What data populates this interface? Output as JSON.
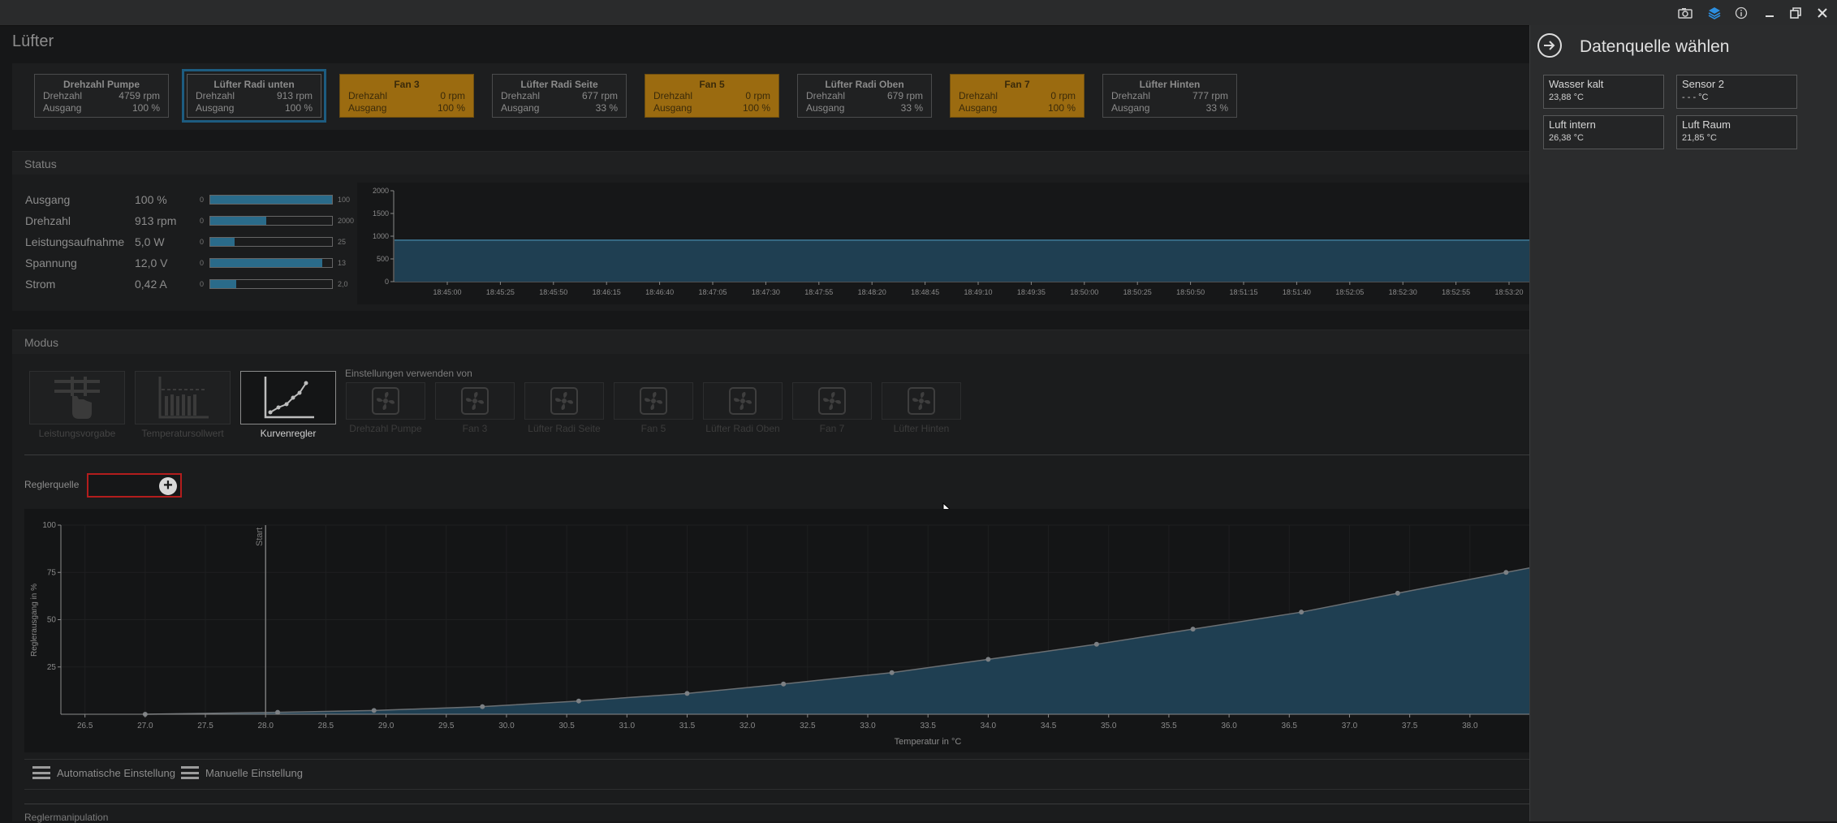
{
  "window": {
    "icons": [
      "camera-icon",
      "layers-icon",
      "info-icon",
      "minimize-icon",
      "restore-icon",
      "close-icon"
    ]
  },
  "page": {
    "title": "Lüfter"
  },
  "fans": [
    {
      "name": "Drehzahl Pumpe",
      "speed_label": "Drehzahl",
      "speed": "4759 rpm",
      "output_label": "Ausgang",
      "output": "100 %",
      "state": "normal"
    },
    {
      "name": "Lüfter Radi unten",
      "speed_label": "Drehzahl",
      "speed": "913 rpm",
      "output_label": "Ausgang",
      "output": "100 %",
      "state": "selected"
    },
    {
      "name": "Fan 3",
      "speed_label": "Drehzahl",
      "speed": "0 rpm",
      "output_label": "Ausgang",
      "output": "100 %",
      "state": "warning"
    },
    {
      "name": "Lüfter Radi Seite",
      "speed_label": "Drehzahl",
      "speed": "677 rpm",
      "output_label": "Ausgang",
      "output": "33 %",
      "state": "normal"
    },
    {
      "name": "Fan 5",
      "speed_label": "Drehzahl",
      "speed": "0 rpm",
      "output_label": "Ausgang",
      "output": "100 %",
      "state": "warning"
    },
    {
      "name": "Lüfter Radi Oben",
      "speed_label": "Drehzahl",
      "speed": "679 rpm",
      "output_label": "Ausgang",
      "output": "33 %",
      "state": "normal"
    },
    {
      "name": "Fan 7",
      "speed_label": "Drehzahl",
      "speed": "0 rpm",
      "output_label": "Ausgang",
      "output": "100 %",
      "state": "warning"
    },
    {
      "name": "Lüfter Hinten",
      "speed_label": "Drehzahl",
      "speed": "777 rpm",
      "output_label": "Ausgang",
      "output": "33 %",
      "state": "normal"
    }
  ],
  "status": {
    "header": "Status",
    "rows": [
      {
        "label": "Ausgang",
        "value": "100 %",
        "min": "0",
        "max": "100",
        "fraction": 1.0
      },
      {
        "label": "Drehzahl",
        "value": "913 rpm",
        "min": "0",
        "max": "2000",
        "fraction": 0.457
      },
      {
        "label": "Leistungsaufnahme",
        "value": "5,0 W",
        "min": "0",
        "max": "25",
        "fraction": 0.2
      },
      {
        "label": "Spannung",
        "value": "12,0 V",
        "min": "0",
        "max": "13",
        "fraction": 0.923
      },
      {
        "label": "Strom",
        "value": "0,42 A",
        "min": "0",
        "max": "2,0",
        "fraction": 0.21
      }
    ],
    "chart": {
      "y_ticks": [
        "2000",
        "1500",
        "1000",
        "500",
        "0"
      ],
      "ylim": [
        0,
        2000
      ],
      "value": 913,
      "x_ticks": [
        "18:45:00",
        "18:45:25",
        "18:45:50",
        "18:46:15",
        "18:46:40",
        "18:47:05",
        "18:47:30",
        "18:47:55",
        "18:48:20",
        "18:48:45",
        "18:49:10",
        "18:49:35",
        "18:50:00",
        "18:50:25",
        "18:50:50",
        "18:51:15",
        "18:51:40",
        "18:52:05",
        "18:52:30",
        "18:52:55",
        "18:53:20"
      ]
    }
  },
  "modus": {
    "header": "Modus",
    "modes": [
      {
        "label": "Leistungsvorgabe",
        "active": false
      },
      {
        "label": "Temperatursollwert",
        "active": false
      },
      {
        "label": "Kurvenregler",
        "active": true
      }
    ],
    "settings_from_label": "Einstellungen verwenden von",
    "settings_fans": [
      "Drehzahl Pumpe",
      "Fan 3",
      "Lüfter Radi Seite",
      "Fan 5",
      "Lüfter Radi Oben",
      "Fan 7",
      "Lüfter Hinten"
    ],
    "reglerquelle_label": "Reglerquelle",
    "auto_label": "Automatische Einstellung",
    "manual_label": "Manuelle Einstellung",
    "reglermanipulation_label": "Reglermanipulation"
  },
  "chart_data": {
    "type": "area",
    "title": "",
    "xlabel": "Temperatur in °C",
    "ylabel": "Reglerausgang in %",
    "xlim": [
      26.3,
      38.5
    ],
    "ylim": [
      0,
      100
    ],
    "x_ticks": [
      "26.5",
      "27.0",
      "27.5",
      "28.0",
      "28.5",
      "29.0",
      "29.5",
      "30.0",
      "30.5",
      "31.0",
      "31.5",
      "32.0",
      "32.5",
      "33.0",
      "33.5",
      "34.0",
      "34.5",
      "35.0",
      "35.5",
      "36.0",
      "36.5",
      "37.0",
      "37.5",
      "38.0"
    ],
    "y_ticks": [
      "100",
      "75",
      "50",
      "25"
    ],
    "start_marker": {
      "x": 28.0,
      "label": "Start"
    },
    "x": [
      27.0,
      28.1,
      28.9,
      29.8,
      30.6,
      31.5,
      32.3,
      33.2,
      34.0,
      34.9,
      35.7,
      36.6,
      37.4,
      38.3
    ],
    "values": [
      0,
      1,
      2,
      4,
      7,
      11,
      16,
      22,
      29,
      37,
      45,
      54,
      64,
      75
    ]
  },
  "source_panel": {
    "title": "Datenquelle wählen",
    "sources": [
      {
        "name": "Wasser kalt",
        "value": "23,88 °C"
      },
      {
        "name": "Sensor 2",
        "value": "- - - °C"
      },
      {
        "name": "Luft intern",
        "value": "26,38 °C"
      },
      {
        "name": "Luft Raum",
        "value": "21,85 °C"
      }
    ]
  }
}
